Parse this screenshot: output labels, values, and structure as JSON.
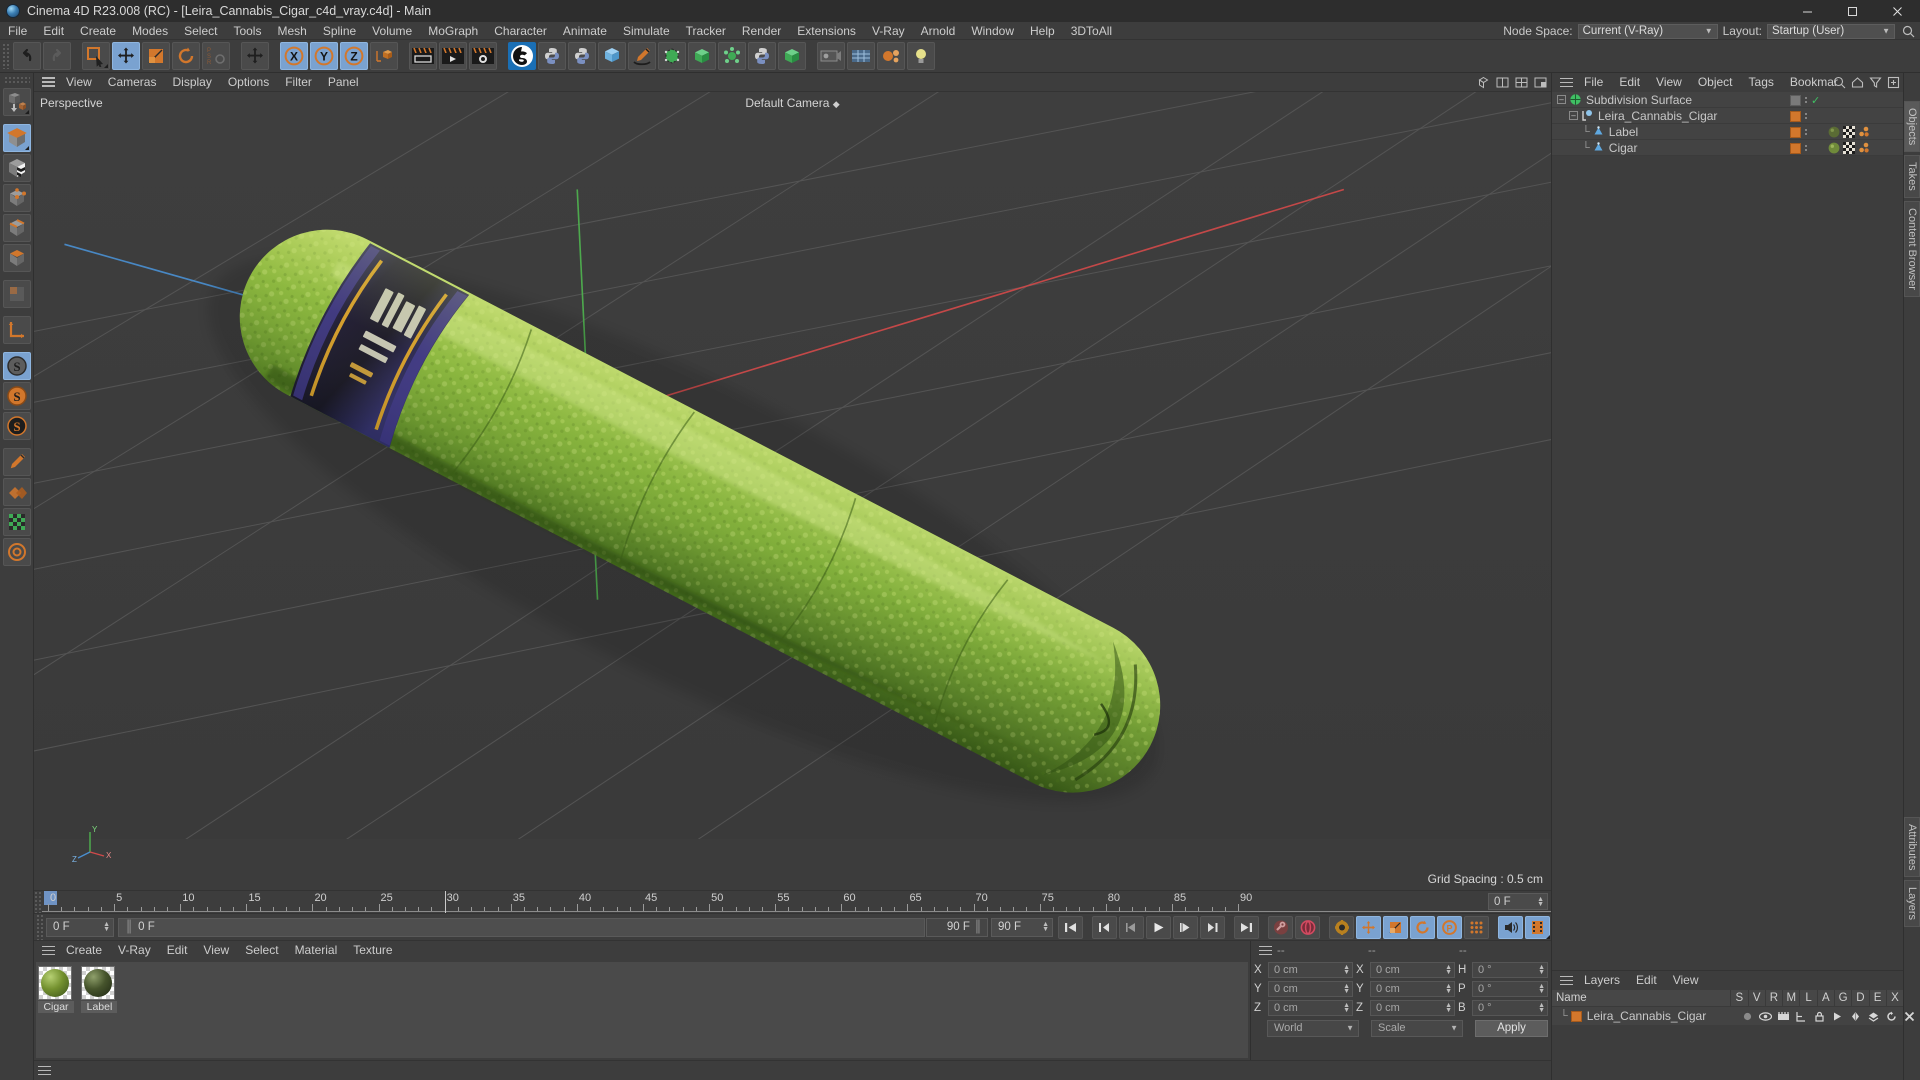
{
  "titlebar": {
    "title": "Cinema 4D R23.008 (RC) - [Leira_Cannabis_Cigar_c4d_vray.c4d] - Main",
    "logo_icon": "c4d-logo-icon",
    "minimize": "—",
    "maximize": "☐",
    "close": "✕"
  },
  "menubar": {
    "items": [
      "File",
      "Edit",
      "Create",
      "Modes",
      "Select",
      "Tools",
      "Mesh",
      "Spline",
      "Volume",
      "MoGraph",
      "Character",
      "Animate",
      "Simulate",
      "Tracker",
      "Render",
      "Extensions",
      "V-Ray",
      "Arnold",
      "Window",
      "Help",
      "3DToAll"
    ],
    "node_space_label": "Node Space:",
    "node_space_value": "Current (V-Ray)",
    "layout_label": "Layout:",
    "layout_value": "Startup (User)",
    "search_icon": "search-icon"
  },
  "toolbar": {
    "buttons": [
      {
        "name": "undo-button",
        "icon": "undo-icon",
        "active": false
      },
      {
        "name": "redo-button",
        "icon": "redo-icon",
        "active": false
      },
      {
        "name": "live-selection-button",
        "icon": "selection-cursor-icon",
        "active": false
      },
      {
        "name": "move-tool-button",
        "icon": "move-arrows-icon",
        "active": true
      },
      {
        "name": "scale-tool-button",
        "icon": "scale-box-icon",
        "active": false
      },
      {
        "name": "rotate-tool-button",
        "icon": "rotate-arc-icon",
        "active": false
      },
      {
        "name": "psr-button",
        "icon": "psr-icon",
        "active": false
      },
      {
        "name": "world-axis-button",
        "icon": "move-arrows-icon",
        "active": false
      },
      {
        "name": "x-axis-button",
        "icon": "axis-x-icon",
        "active": true
      },
      {
        "name": "y-axis-button",
        "icon": "axis-y-icon",
        "active": true
      },
      {
        "name": "z-axis-button",
        "icon": "axis-z-icon",
        "active": true
      },
      {
        "name": "object-world-coord-button",
        "icon": "coordinate-cube-icon",
        "active": false
      },
      {
        "name": "render-view-button",
        "icon": "render-clapper-icon",
        "active": false
      },
      {
        "name": "render-to-picture-viewer-button",
        "icon": "render-play-icon",
        "active": false
      },
      {
        "name": "render-settings-button",
        "icon": "render-gear-icon",
        "active": false
      },
      {
        "name": "redshift-button",
        "icon": "redshift-logo-icon",
        "active": false
      },
      {
        "name": "python-a-button",
        "icon": "python-icon",
        "active": false
      },
      {
        "name": "python-b-button",
        "icon": "python-icon",
        "active": false
      },
      {
        "name": "primitive-cube-button",
        "icon": "blue-cube-icon",
        "active": false
      },
      {
        "name": "spline-pen-button",
        "icon": "pen-nib-icon",
        "active": false
      },
      {
        "name": "nurbs-button",
        "icon": "green-cage-cube-icon",
        "active": false
      },
      {
        "name": "array-button",
        "icon": "green-cube-icon",
        "active": false
      },
      {
        "name": "deformer-button",
        "icon": "green-molecule-icon",
        "active": false
      },
      {
        "name": "python-c-button",
        "icon": "python-icon",
        "active": false
      },
      {
        "name": "scene-button",
        "icon": "green-cube-icon",
        "active": false
      },
      {
        "name": "camera-button",
        "icon": "camera-icon",
        "active": false
      },
      {
        "name": "light-button",
        "icon": "bulb-icon",
        "active": false
      }
    ]
  },
  "leftbar": {
    "buttons": [
      {
        "name": "make-editable-button",
        "icon": "make-editable-icon",
        "active": false
      },
      {
        "name": "model-mode-button",
        "icon": "model-cube-icon",
        "active": true
      },
      {
        "name": "texture-mode-button",
        "icon": "texture-cube-icon",
        "active": false
      },
      {
        "name": "points-mode-button",
        "icon": "points-cube-icon",
        "active": false
      },
      {
        "name": "edges-mode-button",
        "icon": "edges-cube-icon",
        "active": false
      },
      {
        "name": "polygons-mode-button",
        "icon": "polygons-cube-icon",
        "active": false
      },
      {
        "name": "uv-mode-button",
        "icon": "uv-grid-icon",
        "active": false
      },
      {
        "name": "axis-modify-button",
        "icon": "axis-corner-icon",
        "active": false
      },
      {
        "name": "enable-snap-button",
        "icon": "snap-dark-icon",
        "active": true
      },
      {
        "name": "snap-settings-button",
        "icon": "snap-orange-icon",
        "active": false
      },
      {
        "name": "workplane-button",
        "icon": "snap-black-icon",
        "active": false
      },
      {
        "name": "viewport-solo-button",
        "icon": "pencil-icon",
        "active": false
      },
      {
        "name": "visibility-button",
        "icon": "hatch-icon",
        "active": false
      },
      {
        "name": "layer-button",
        "icon": "layer-grid-icon",
        "active": false
      },
      {
        "name": "misc-button",
        "icon": "orange-circle-icon",
        "active": false
      }
    ]
  },
  "viewport": {
    "menu_items": [
      "View",
      "Cameras",
      "Display",
      "Options",
      "Filter",
      "Panel"
    ],
    "hamburger_icon": "hamburger-icon",
    "label": "Perspective",
    "camera_label": "Default Camera",
    "grid_spacing": "Grid Spacing : 0.5 cm",
    "axis_labels": {
      "x": "X",
      "y": "Y",
      "z": "Z"
    },
    "right_icons": [
      "view-single-icon",
      "view-two-icon",
      "view-four-icon",
      "view-maximize-icon"
    ]
  },
  "timeline": {
    "ticks": [
      0,
      5,
      10,
      15,
      20,
      25,
      30,
      35,
      40,
      45,
      50,
      55,
      60,
      65,
      70,
      75,
      80,
      85,
      90
    ],
    "current_frame_marker": 0,
    "end_field": "0 F"
  },
  "transport": {
    "current_frame": "0 F",
    "range_start": "0 F",
    "range_end": "90 F",
    "preview_end": "90 F",
    "buttons": [
      {
        "name": "go-to-start-button",
        "icon": "skip-start-icon",
        "active": false
      },
      {
        "name": "go-to-previous-key-button",
        "icon": "prev-key-icon",
        "active": false
      },
      {
        "name": "step-back-button",
        "icon": "step-back-icon",
        "active": false
      },
      {
        "name": "play-button",
        "icon": "play-icon",
        "active": false
      },
      {
        "name": "step-forward-button",
        "icon": "step-forward-icon",
        "active": false
      },
      {
        "name": "go-to-next-key-button",
        "icon": "next-key-icon",
        "active": false
      },
      {
        "name": "go-to-end-button",
        "icon": "skip-end-icon",
        "active": false
      },
      {
        "name": "record-active-objects-button",
        "icon": "key-icon",
        "active": false
      },
      {
        "name": "autokeying-button",
        "icon": "record-circle-icon",
        "active": false
      },
      {
        "name": "keyframe-selection-button",
        "icon": "keyframe-gear-icon",
        "active": false
      },
      {
        "name": "position-key-button",
        "icon": "position-key-icon",
        "active": true
      },
      {
        "name": "scale-key-button",
        "icon": "scale-key-icon",
        "active": true
      },
      {
        "name": "rotation-key-button",
        "icon": "rotation-key-icon",
        "active": true
      },
      {
        "name": "param-key-button",
        "icon": "param-key-icon",
        "active": true
      },
      {
        "name": "point-level-animation-button",
        "icon": "dots-grid-icon",
        "active": false
      },
      {
        "name": "sound-button",
        "icon": "speaker-icon",
        "active": true
      },
      {
        "name": "film-button",
        "icon": "film-strip-icon",
        "active": true
      }
    ]
  },
  "material_manager": {
    "hamburger_icon": "hamburger-icon",
    "menu_items": [
      "Create",
      "V-Ray",
      "Edit",
      "View",
      "Select",
      "Material",
      "Texture"
    ],
    "materials": [
      {
        "name": "Cigar",
        "color": "#6f8a3a"
      },
      {
        "name": "Label",
        "color": "#3d4a28"
      }
    ]
  },
  "coordinates": {
    "hamburger_icon": "hamburger-icon",
    "headers": [
      "--",
      "--",
      "--"
    ],
    "rows": [
      {
        "pos_label": "X",
        "pos_value": "0 cm",
        "size_label": "X",
        "size_value": "0 cm",
        "rot_label": "H",
        "rot_value": "0 °"
      },
      {
        "pos_label": "Y",
        "pos_value": "0 cm",
        "size_label": "Y",
        "size_value": "0 cm",
        "rot_label": "P",
        "rot_value": "0 °"
      },
      {
        "pos_label": "Z",
        "pos_value": "0 cm",
        "size_label": "Z",
        "size_value": "0 cm",
        "rot_label": "B",
        "rot_value": "0 °"
      }
    ],
    "system_select": "World",
    "mode_select": "Scale",
    "apply_label": "Apply"
  },
  "object_manager": {
    "hamburger_icon": "hamburger-icon",
    "menu_items": [
      "File",
      "Edit",
      "View",
      "Object",
      "Tags",
      "Bookmar"
    ],
    "right_icons": [
      "search-icon",
      "home-icon",
      "filter-icon",
      "add-icon"
    ],
    "rows": [
      {
        "name": "Subdivision Surface",
        "depth": 0,
        "icon": "subdivision-surface-icon",
        "has_expander": true,
        "tag_square": "#7a7a7a",
        "check": true,
        "tags": []
      },
      {
        "name": "Leira_Cannabis_Cigar",
        "depth": 1,
        "icon": "null-object-icon",
        "has_expander": true,
        "tag_square": "#d2772c",
        "check": false,
        "tags": []
      },
      {
        "name": "Label",
        "depth": 2,
        "icon": "polygon-object-icon",
        "has_expander": false,
        "tag_square": "#d2772c",
        "check": false,
        "tags": [
          "material-tag-icon",
          "uvw-tag-icon",
          "selection-tag-icon"
        ]
      },
      {
        "name": "Cigar",
        "depth": 2,
        "icon": "polygon-object-icon",
        "has_expander": false,
        "tag_square": "#d2772c",
        "check": false,
        "tags": [
          "material-tag-icon",
          "uvw-tag-icon",
          "selection-tag-icon"
        ]
      }
    ]
  },
  "layers_manager": {
    "hamburger_icon": "hamburger-icon",
    "menu_items": [
      "Layers",
      "Edit",
      "View"
    ],
    "name_header": "Name",
    "columns": [
      "S",
      "V",
      "R",
      "M",
      "L",
      "A",
      "G",
      "D",
      "E",
      "X"
    ],
    "rows": [
      {
        "name": "Leira_Cannabis_Cigar",
        "color": "#d2772c"
      }
    ]
  },
  "right_tabs": [
    "Objects",
    "Takes",
    "Content Browser"
  ],
  "bottom_right_tabs": [
    "Attributes",
    "Layers"
  ],
  "colors": {
    "accent_blue": "#7aa2d0",
    "accent_orange": "#d2772c",
    "panel_bg": "#3d3d3d",
    "field_bg": "#4a4a4a",
    "viewport_bg": "#3c3c3c"
  }
}
